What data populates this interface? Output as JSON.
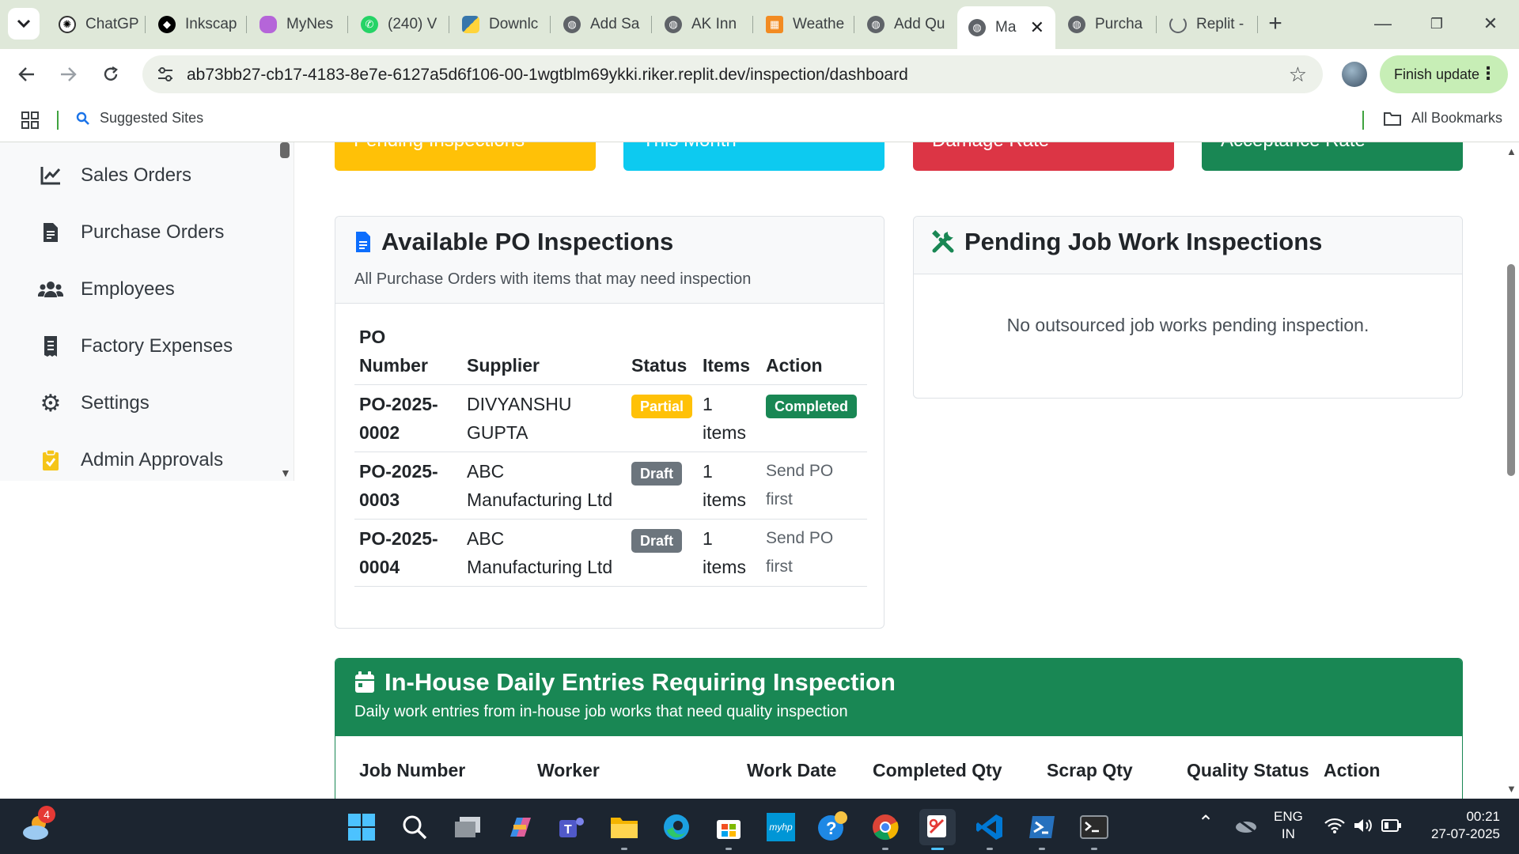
{
  "browser": {
    "tabs": [
      {
        "label": "ChatGP",
        "icon": "chatgpt-icon"
      },
      {
        "label": "Inkscap",
        "icon": "inkscape-icon"
      },
      {
        "label": "MyNes",
        "icon": "mynest-icon"
      },
      {
        "label": "(240) V",
        "icon": "whatsapp-icon"
      },
      {
        "label": "Downlc",
        "icon": "python-icon"
      },
      {
        "label": "Add Sa",
        "icon": "globe-icon"
      },
      {
        "label": "AK Inn",
        "icon": "globe-icon"
      },
      {
        "label": "Weathe",
        "icon": "weather-icon"
      },
      {
        "label": "Add Qu",
        "icon": "globe-icon"
      },
      {
        "label": "Ma",
        "icon": "globe-icon",
        "active": true
      },
      {
        "label": "Purcha",
        "icon": "globe-icon"
      },
      {
        "label": "Replit -",
        "icon": "loading-icon"
      }
    ],
    "url": "ab73bb27-cb17-4183-8e7e-6127a5d6f106-00-1wgtblm69ykki.riker.replit.dev/inspection/dashboard",
    "finish_update_label": "Finish update",
    "bookmarks": {
      "suggested": "Suggested Sites",
      "all": "All Bookmarks"
    }
  },
  "sidebar": {
    "items": [
      {
        "label": "Sales Orders",
        "icon": "chart-line-icon"
      },
      {
        "label": "Purchase Orders",
        "icon": "file-invoice-icon"
      },
      {
        "label": "Employees",
        "icon": "users-icon"
      },
      {
        "label": "Factory Expenses",
        "icon": "receipt-icon"
      },
      {
        "label": "Settings",
        "icon": "gear-icon"
      },
      {
        "label": "Admin Approvals",
        "icon": "clipboard-check-icon"
      }
    ]
  },
  "stats": [
    {
      "label": "Pending Inspections",
      "color": "#ffc107"
    },
    {
      "label": "This Month",
      "color": "#0dcaf0"
    },
    {
      "label": "Damage Rate",
      "color": "#dc3545"
    },
    {
      "label": "Acceptance Rate",
      "color": "#198754"
    }
  ],
  "po_inspections": {
    "title": "Available PO Inspections",
    "subtitle": "All Purchase Orders with items that may need inspection",
    "columns": [
      "PO Number",
      "Supplier",
      "Status",
      "Items",
      "Action"
    ],
    "rows": [
      {
        "po": "PO-2025-0002",
        "supplier": "DIVYANSHU GUPTA",
        "status": "Partial",
        "status_color": "#ffc107",
        "items": "1 items",
        "action": "Completed"
      },
      {
        "po": "PO-2025-0003",
        "supplier": "ABC Manufacturing Ltd",
        "status": "Draft",
        "status_color": "#6c757d",
        "items": "1 items",
        "action": "Send PO first"
      },
      {
        "po": "PO-2025-0004",
        "supplier": "ABC Manufacturing Ltd",
        "status": "Draft",
        "status_color": "#6c757d",
        "items": "1 items",
        "action": "Send PO first"
      }
    ]
  },
  "job_work": {
    "title": "Pending Job Work Inspections",
    "empty_message": "No outsourced job works pending inspection."
  },
  "daily_entries": {
    "title": "In-House Daily Entries Requiring Inspection",
    "subtitle": "Daily work entries from in-house job works that need quality inspection",
    "columns": [
      "Job Number",
      "Worker",
      "Work Date",
      "Completed Qty",
      "Scrap Qty",
      "Quality Status",
      "Action"
    ]
  },
  "taskbar": {
    "weather_badge": "4",
    "language": "ENG",
    "region": "IN",
    "time": "00:21",
    "date": "27-07-2025"
  }
}
